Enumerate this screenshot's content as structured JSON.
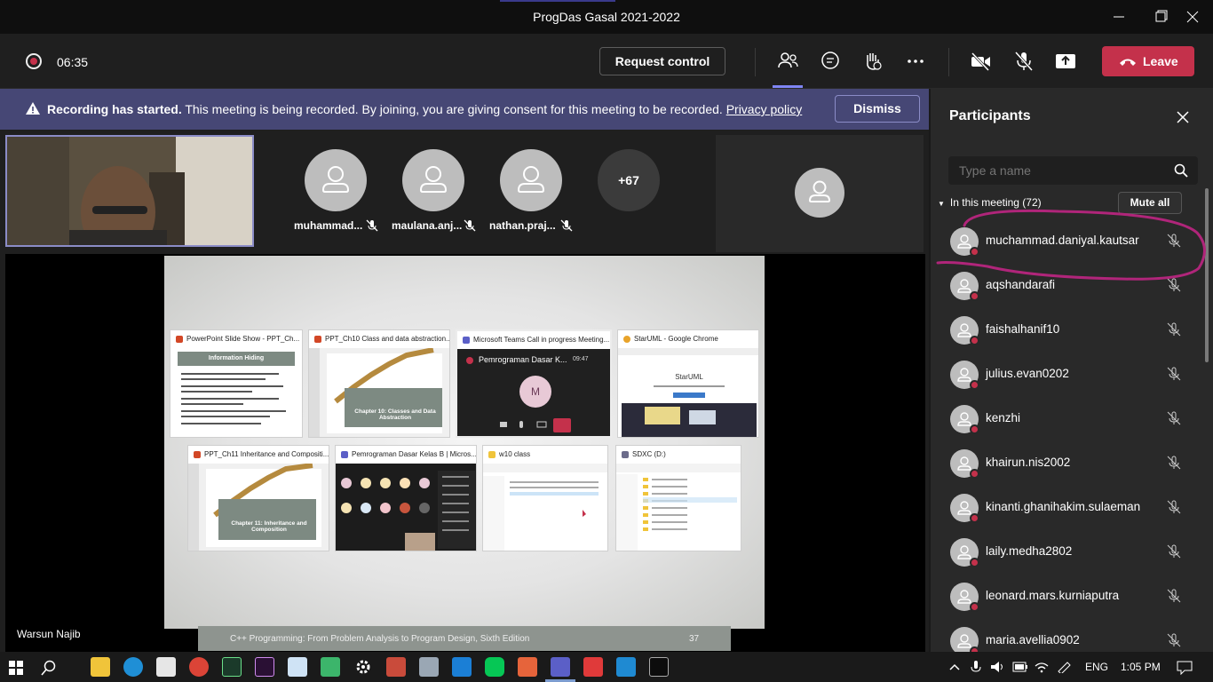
{
  "window": {
    "title": "ProgDas Gasal 2021-2022"
  },
  "topbar": {
    "timer": "06:35",
    "request_control": "Request control",
    "leave": "Leave",
    "icons": [
      "people-icon",
      "chat-icon",
      "raise-hand-icon",
      "more-icon",
      "camera-off-icon",
      "mic-off-icon",
      "share-icon"
    ]
  },
  "banner": {
    "bold": "Recording has started.",
    "text": " This meeting is being recorded. By joining, you are giving consent for this meeting to be recorded. ",
    "link": "Privacy policy",
    "dismiss": "Dismiss"
  },
  "video_row": {
    "tiles": [
      {
        "name": "muhammad..."
      },
      {
        "name": "maulana.anj..."
      },
      {
        "name": "nathan.praj..."
      }
    ],
    "more": "+67"
  },
  "shared_screen": {
    "thumbnails": [
      {
        "title": "PowerPoint Slide Show - PPT_Ch...",
        "heading": "Information Hiding"
      },
      {
        "title": "PPT_Ch10 Class and data abstraction...",
        "heading": "Chapter 10: Classes and Data Abstraction"
      },
      {
        "title": "Microsoft Teams Call in progress Meeting...",
        "heading": "Pemrograman Dasar K...",
        "time": "09:47",
        "avatar": "M"
      },
      {
        "title": "StarUML - Google Chrome",
        "heading": "StarUML"
      },
      {
        "title": "PPT_Ch11 Inheritance and Compositi...",
        "heading": "Chapter 11: Inheritance and Composition"
      },
      {
        "title": "Pemrograman Dasar Kelas B | Micros...",
        "heading": ""
      },
      {
        "title": "w10 class",
        "heading": ""
      },
      {
        "title": "SDXC (D:)",
        "heading": ""
      }
    ],
    "footer_text": "C++ Programming: From Problem Analysis to Program Design, Sixth Edition",
    "page_number": "37",
    "presenter": "Warsun Najib"
  },
  "participants_panel": {
    "title": "Participants",
    "search_placeholder": "Type a name",
    "in_meeting": "In this meeting (72)",
    "mute_all": "Mute all",
    "people": [
      "muchammad.daniyal.kautsar",
      "aqshandarafi",
      "faishalhanif10",
      "julius.evan0202",
      "kenzhi",
      "khairun.nis2002",
      "kinanti.ghanihakim.sulaeman",
      "laily.medha2802",
      "leonard.mars.kurniaputra",
      "maria.avellia0902"
    ]
  },
  "taskbar": {
    "language": "ENG",
    "time": "1:05 PM"
  },
  "colors": {
    "accent": "#464775",
    "leave": "#c4314b",
    "annotation": "#b0257a"
  }
}
